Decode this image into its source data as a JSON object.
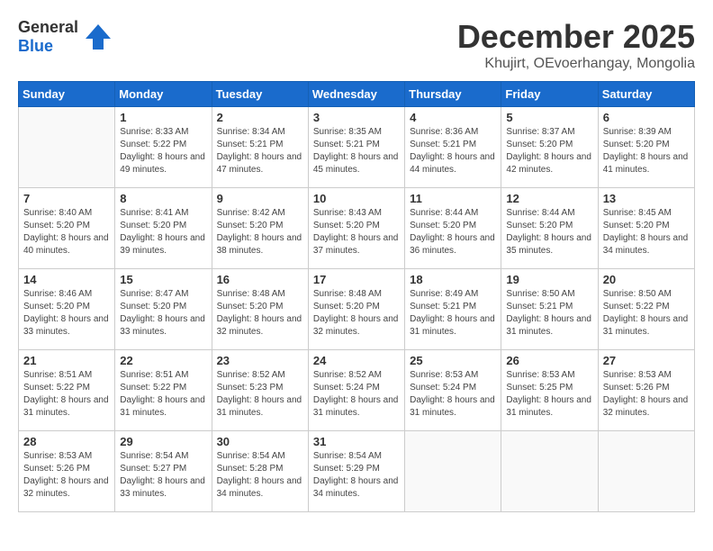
{
  "logo": {
    "general": "General",
    "blue": "Blue"
  },
  "title": "December 2025",
  "location": "Khujirt, OEvoerhangay, Mongolia",
  "days_of_week": [
    "Sunday",
    "Monday",
    "Tuesday",
    "Wednesday",
    "Thursday",
    "Friday",
    "Saturday"
  ],
  "weeks": [
    [
      {
        "day": "",
        "sunrise": "",
        "sunset": "",
        "daylight": ""
      },
      {
        "day": "1",
        "sunrise": "Sunrise: 8:33 AM",
        "sunset": "Sunset: 5:22 PM",
        "daylight": "Daylight: 8 hours and 49 minutes."
      },
      {
        "day": "2",
        "sunrise": "Sunrise: 8:34 AM",
        "sunset": "Sunset: 5:21 PM",
        "daylight": "Daylight: 8 hours and 47 minutes."
      },
      {
        "day": "3",
        "sunrise": "Sunrise: 8:35 AM",
        "sunset": "Sunset: 5:21 PM",
        "daylight": "Daylight: 8 hours and 45 minutes."
      },
      {
        "day": "4",
        "sunrise": "Sunrise: 8:36 AM",
        "sunset": "Sunset: 5:21 PM",
        "daylight": "Daylight: 8 hours and 44 minutes."
      },
      {
        "day": "5",
        "sunrise": "Sunrise: 8:37 AM",
        "sunset": "Sunset: 5:20 PM",
        "daylight": "Daylight: 8 hours and 42 minutes."
      },
      {
        "day": "6",
        "sunrise": "Sunrise: 8:39 AM",
        "sunset": "Sunset: 5:20 PM",
        "daylight": "Daylight: 8 hours and 41 minutes."
      }
    ],
    [
      {
        "day": "7",
        "sunrise": "Sunrise: 8:40 AM",
        "sunset": "Sunset: 5:20 PM",
        "daylight": "Daylight: 8 hours and 40 minutes."
      },
      {
        "day": "8",
        "sunrise": "Sunrise: 8:41 AM",
        "sunset": "Sunset: 5:20 PM",
        "daylight": "Daylight: 8 hours and 39 minutes."
      },
      {
        "day": "9",
        "sunrise": "Sunrise: 8:42 AM",
        "sunset": "Sunset: 5:20 PM",
        "daylight": "Daylight: 8 hours and 38 minutes."
      },
      {
        "day": "10",
        "sunrise": "Sunrise: 8:43 AM",
        "sunset": "Sunset: 5:20 PM",
        "daylight": "Daylight: 8 hours and 37 minutes."
      },
      {
        "day": "11",
        "sunrise": "Sunrise: 8:44 AM",
        "sunset": "Sunset: 5:20 PM",
        "daylight": "Daylight: 8 hours and 36 minutes."
      },
      {
        "day": "12",
        "sunrise": "Sunrise: 8:44 AM",
        "sunset": "Sunset: 5:20 PM",
        "daylight": "Daylight: 8 hours and 35 minutes."
      },
      {
        "day": "13",
        "sunrise": "Sunrise: 8:45 AM",
        "sunset": "Sunset: 5:20 PM",
        "daylight": "Daylight: 8 hours and 34 minutes."
      }
    ],
    [
      {
        "day": "14",
        "sunrise": "Sunrise: 8:46 AM",
        "sunset": "Sunset: 5:20 PM",
        "daylight": "Daylight: 8 hours and 33 minutes."
      },
      {
        "day": "15",
        "sunrise": "Sunrise: 8:47 AM",
        "sunset": "Sunset: 5:20 PM",
        "daylight": "Daylight: 8 hours and 33 minutes."
      },
      {
        "day": "16",
        "sunrise": "Sunrise: 8:48 AM",
        "sunset": "Sunset: 5:20 PM",
        "daylight": "Daylight: 8 hours and 32 minutes."
      },
      {
        "day": "17",
        "sunrise": "Sunrise: 8:48 AM",
        "sunset": "Sunset: 5:20 PM",
        "daylight": "Daylight: 8 hours and 32 minutes."
      },
      {
        "day": "18",
        "sunrise": "Sunrise: 8:49 AM",
        "sunset": "Sunset: 5:21 PM",
        "daylight": "Daylight: 8 hours and 31 minutes."
      },
      {
        "day": "19",
        "sunrise": "Sunrise: 8:50 AM",
        "sunset": "Sunset: 5:21 PM",
        "daylight": "Daylight: 8 hours and 31 minutes."
      },
      {
        "day": "20",
        "sunrise": "Sunrise: 8:50 AM",
        "sunset": "Sunset: 5:22 PM",
        "daylight": "Daylight: 8 hours and 31 minutes."
      }
    ],
    [
      {
        "day": "21",
        "sunrise": "Sunrise: 8:51 AM",
        "sunset": "Sunset: 5:22 PM",
        "daylight": "Daylight: 8 hours and 31 minutes."
      },
      {
        "day": "22",
        "sunrise": "Sunrise: 8:51 AM",
        "sunset": "Sunset: 5:22 PM",
        "daylight": "Daylight: 8 hours and 31 minutes."
      },
      {
        "day": "23",
        "sunrise": "Sunrise: 8:52 AM",
        "sunset": "Sunset: 5:23 PM",
        "daylight": "Daylight: 8 hours and 31 minutes."
      },
      {
        "day": "24",
        "sunrise": "Sunrise: 8:52 AM",
        "sunset": "Sunset: 5:24 PM",
        "daylight": "Daylight: 8 hours and 31 minutes."
      },
      {
        "day": "25",
        "sunrise": "Sunrise: 8:53 AM",
        "sunset": "Sunset: 5:24 PM",
        "daylight": "Daylight: 8 hours and 31 minutes."
      },
      {
        "day": "26",
        "sunrise": "Sunrise: 8:53 AM",
        "sunset": "Sunset: 5:25 PM",
        "daylight": "Daylight: 8 hours and 31 minutes."
      },
      {
        "day": "27",
        "sunrise": "Sunrise: 8:53 AM",
        "sunset": "Sunset: 5:26 PM",
        "daylight": "Daylight: 8 hours and 32 minutes."
      }
    ],
    [
      {
        "day": "28",
        "sunrise": "Sunrise: 8:53 AM",
        "sunset": "Sunset: 5:26 PM",
        "daylight": "Daylight: 8 hours and 32 minutes."
      },
      {
        "day": "29",
        "sunrise": "Sunrise: 8:54 AM",
        "sunset": "Sunset: 5:27 PM",
        "daylight": "Daylight: 8 hours and 33 minutes."
      },
      {
        "day": "30",
        "sunrise": "Sunrise: 8:54 AM",
        "sunset": "Sunset: 5:28 PM",
        "daylight": "Daylight: 8 hours and 34 minutes."
      },
      {
        "day": "31",
        "sunrise": "Sunrise: 8:54 AM",
        "sunset": "Sunset: 5:29 PM",
        "daylight": "Daylight: 8 hours and 34 minutes."
      },
      {
        "day": "",
        "sunrise": "",
        "sunset": "",
        "daylight": ""
      },
      {
        "day": "",
        "sunrise": "",
        "sunset": "",
        "daylight": ""
      },
      {
        "day": "",
        "sunrise": "",
        "sunset": "",
        "daylight": ""
      }
    ]
  ]
}
